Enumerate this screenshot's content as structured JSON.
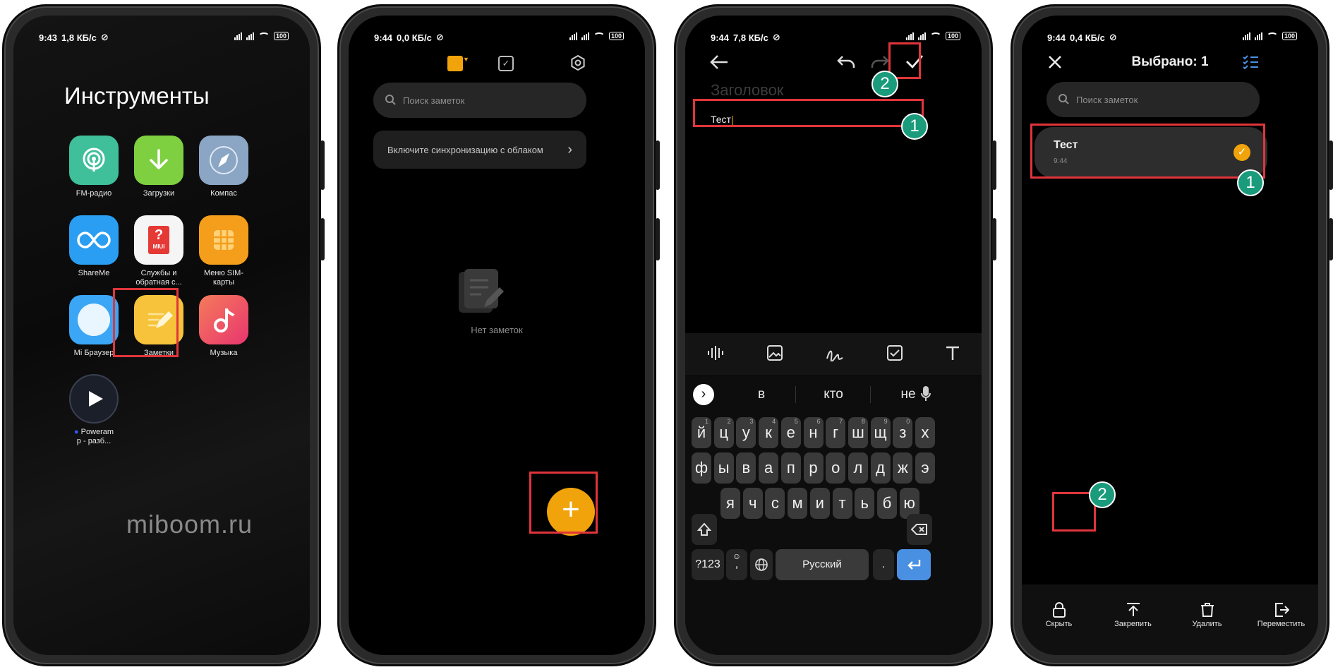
{
  "watermark": "miboom.ru",
  "colors": {
    "accent": "#f0a30a",
    "highlight": "#e0353b",
    "badge": "#1a9b7c",
    "enter_key": "#4a90e2"
  },
  "phone1": {
    "status": {
      "time": "9:43",
      "speed": "1,8 КБ/с",
      "battery": "100"
    },
    "folder_title": "Инструменты",
    "apps": [
      {
        "label": "FM-радио",
        "icon": "radio-icon",
        "color": "#3fbf9a"
      },
      {
        "label": "Загрузки",
        "icon": "download-icon",
        "color": "#7ed040"
      },
      {
        "label": "Компас",
        "icon": "compass-icon",
        "color": "#8aa6c4"
      },
      {
        "label": "ShareMe",
        "icon": "shareme-icon",
        "color": "#2a9ef2"
      },
      {
        "label": "Службы и обратная с...",
        "icon": "feedback-icon",
        "color": "#f5f5f5",
        "badge": "MIUI"
      },
      {
        "label": "Меню SIM-карты",
        "icon": "sim-icon",
        "color": "#f59e1b"
      },
      {
        "label": "Mi Браузер",
        "icon": "browser-icon",
        "color": "#3aa6f5"
      },
      {
        "label": "Заметки",
        "icon": "notes-icon",
        "color": "#f7c33b"
      },
      {
        "label": "Музыка",
        "icon": "music-icon",
        "color": "#f04d6a"
      },
      {
        "label": "Poweram p - разб...",
        "icon": "poweramp-icon",
        "color": "#1b1f2a"
      }
    ]
  },
  "phone2": {
    "status": {
      "time": "9:44",
      "speed": "0,0 КБ/с",
      "battery": "100"
    },
    "search_placeholder": "Поиск заметок",
    "sync_text": "Включите синхронизацию с облаком",
    "empty_text": "Нет заметок",
    "fab_label": "+"
  },
  "phone3": {
    "status": {
      "time": "9:44",
      "speed": "7,8 КБ/с",
      "battery": "100"
    },
    "title_placeholder": "Заголовок",
    "body_text": "Тест",
    "badge1": "1",
    "badge2": "2",
    "suggestions": [
      "в",
      "кто",
      "не"
    ],
    "rows": [
      [
        [
          "й",
          "1"
        ],
        [
          "ц",
          "2"
        ],
        [
          "у",
          "3"
        ],
        [
          "к",
          "4"
        ],
        [
          "е",
          "5"
        ],
        [
          "н",
          "6"
        ],
        [
          "г",
          "7"
        ],
        [
          "ш",
          "8"
        ],
        [
          "щ",
          "9"
        ],
        [
          "з",
          "0"
        ],
        [
          "х",
          ""
        ]
      ],
      [
        [
          "ф",
          ""
        ],
        [
          "ы",
          ""
        ],
        [
          "в",
          ""
        ],
        [
          "а",
          ""
        ],
        [
          "п",
          ""
        ],
        [
          "р",
          ""
        ],
        [
          "о",
          ""
        ],
        [
          "л",
          ""
        ],
        [
          "д",
          ""
        ],
        [
          "ж",
          ""
        ],
        [
          "э",
          ""
        ]
      ],
      [
        [
          "я",
          ""
        ],
        [
          "ч",
          ""
        ],
        [
          "с",
          ""
        ],
        [
          "м",
          ""
        ],
        [
          "и",
          ""
        ],
        [
          "т",
          ""
        ],
        [
          "ь",
          ""
        ],
        [
          "б",
          ""
        ],
        [
          "ю",
          ""
        ]
      ]
    ],
    "sym_key": "?123",
    "comma_key": ",",
    "space_label": "Русский",
    "period_key": "."
  },
  "phone4": {
    "status": {
      "time": "9:44",
      "speed": "0,4 КБ/с",
      "battery": "100"
    },
    "header_title": "Выбрано: 1",
    "search_placeholder": "Поиск заметок",
    "note_title": "Тест",
    "note_time": "9:44",
    "badge1": "1",
    "badge2": "2",
    "actions": [
      {
        "label": "Скрыть",
        "icon": "lock-icon"
      },
      {
        "label": "Закрепить",
        "icon": "pin-icon"
      },
      {
        "label": "Удалить",
        "icon": "trash-icon"
      },
      {
        "label": "Переместить",
        "icon": "move-icon"
      }
    ]
  }
}
